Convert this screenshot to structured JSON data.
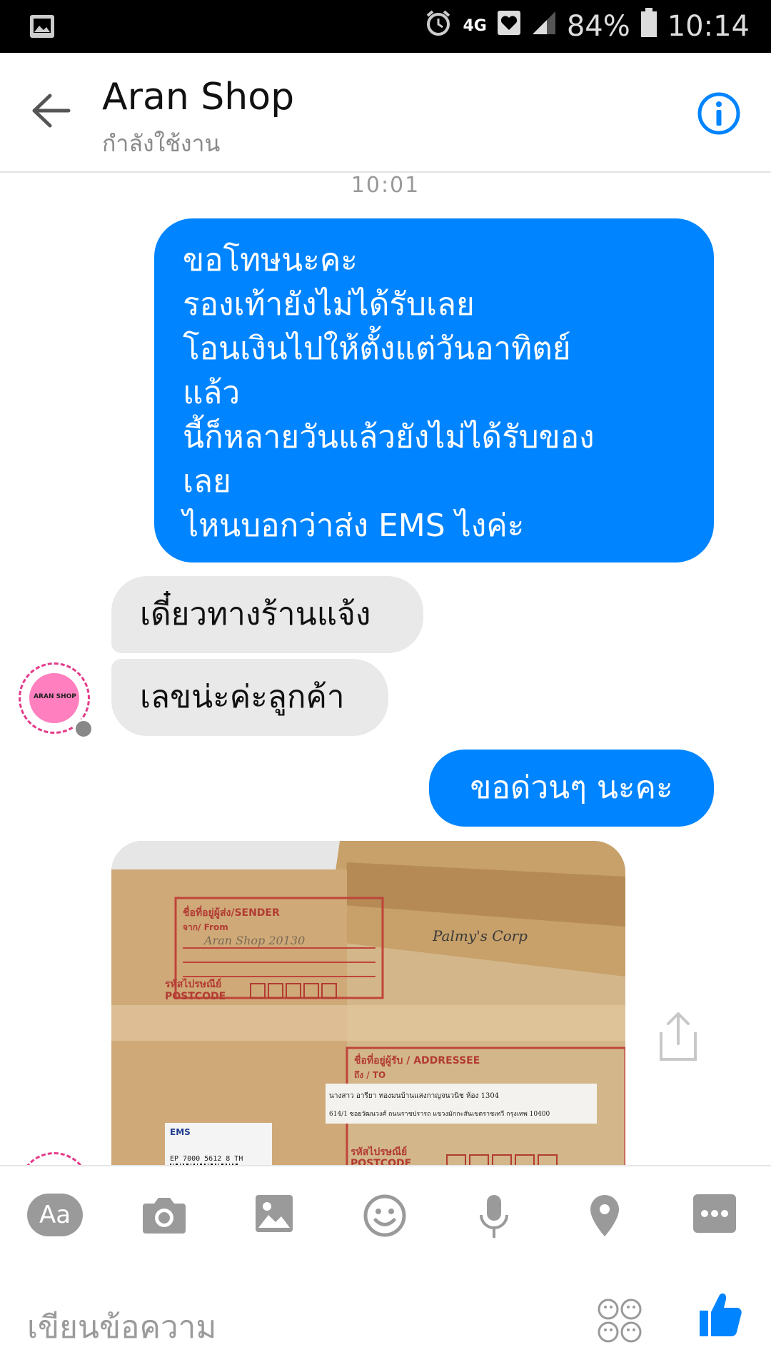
{
  "status_bar": {
    "network": "4G",
    "battery": "84%",
    "time": "10:14"
  },
  "header": {
    "title": "Aran Shop",
    "subtitle": "กำลังใช้งาน"
  },
  "chat": {
    "timestamp": "10:01",
    "messages": [
      {
        "direction": "outgoing",
        "text": "ขอโทษนะคะ\nรองเท้ายังไม่ได้รับเลย\nโอนเงินไปให้ตั้งแต่วันอาทิตย์\nแล้ว\nนี้ก็หลายวันแล้วยังไม่ได้รับของ\nเลย\nไหนบอกว่าส่ง EMS ไงค่ะ"
      },
      {
        "direction": "incoming",
        "text": "เดี๋ยวทางร้านแจ้ง"
      },
      {
        "direction": "incoming",
        "text": "เลขน่ะค่ะลูกค้า"
      },
      {
        "direction": "outgoing",
        "text": "ขอด่วนๆ นะคะ"
      }
    ],
    "avatar_label": "ARAN SHOP",
    "photo": {
      "sender_label": "ชื่อที่อยู่ผู้ส่ง/SENDER",
      "from_label": "จาก/ From",
      "handwritten_from": "Aran Shop 20130",
      "postcode_label_th": "รหัสไปรษณีย์",
      "postcode_label_en": "POSTCODE",
      "handwritten_note": "Palmy's Corp",
      "addressee_label": "ชื่อที่อยู่ผู้รับ / ADDRESSEE",
      "to_label": "ถึง / TO",
      "address_line1": "นางสาว อารียา ทองมนบ้านแสงกาญจนวนิช ห้อง 1304",
      "address_line2": "614/1 ซอยวัฒนวงศ์ ถนนราชปรารถ แขวงมักกะสันเขตราชเทวี กรุงเทพ 10400",
      "ems_label": "EMS",
      "tracking": "EP 7000 5612 8 TH"
    }
  },
  "composer": {
    "placeholder": "เขียนข้อความ",
    "text_button": "Aa"
  },
  "colors": {
    "accent": "#0084ff",
    "incoming_bubble": "#e9e9ea",
    "header_icon": "#0084ff"
  }
}
